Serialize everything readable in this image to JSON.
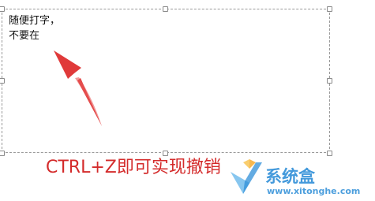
{
  "text_box": {
    "content": "随便打字，\n不要在"
  },
  "caption": {
    "text": "CTRL+Z即可实现撤销"
  },
  "watermark": {
    "name": "系统盒",
    "url": "www.xitonghe.com"
  },
  "colors": {
    "arrow": "#e03a3a",
    "caption": "#d42b2b",
    "watermark": "#2f8fd8",
    "box_border": "#9a9a9a"
  }
}
